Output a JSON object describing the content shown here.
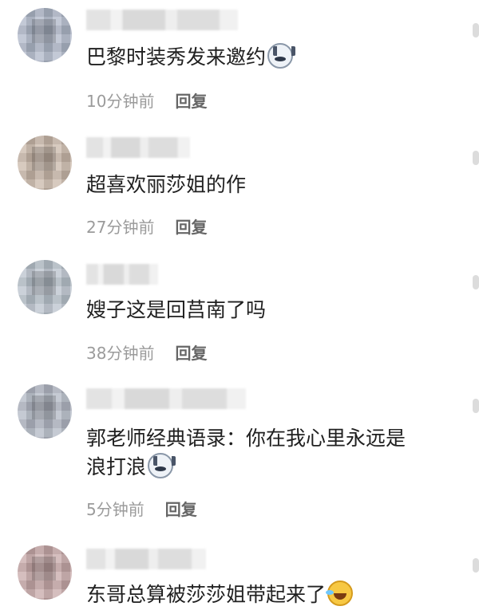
{
  "comments": [
    {
      "text": "巴黎时装秀发来邀约",
      "time": "10分钟前",
      "reply": "回复",
      "avatar_color": "#aeb7c8",
      "emoji": "husky-emoji"
    },
    {
      "text": "超喜欢丽莎姐的作",
      "time": "27分钟前",
      "reply": "回复",
      "avatar_color": "#c9b8aa"
    },
    {
      "text": "嫂子这是回莒南了吗",
      "time": "38分钟前",
      "reply": "回复",
      "avatar_color": "#b9c2cc"
    },
    {
      "text_line1": "郭老师经典语录：你在我心里永远是",
      "text_line2": "浪打浪",
      "time": "5分钟前",
      "reply": "回复",
      "avatar_color": "#b2b8c4",
      "emoji": "husky-emoji"
    },
    {
      "text": "东哥总算被莎莎姐带起来了",
      "avatar_color": "#c7a8a8",
      "emoji": "laughing-emoji"
    }
  ]
}
